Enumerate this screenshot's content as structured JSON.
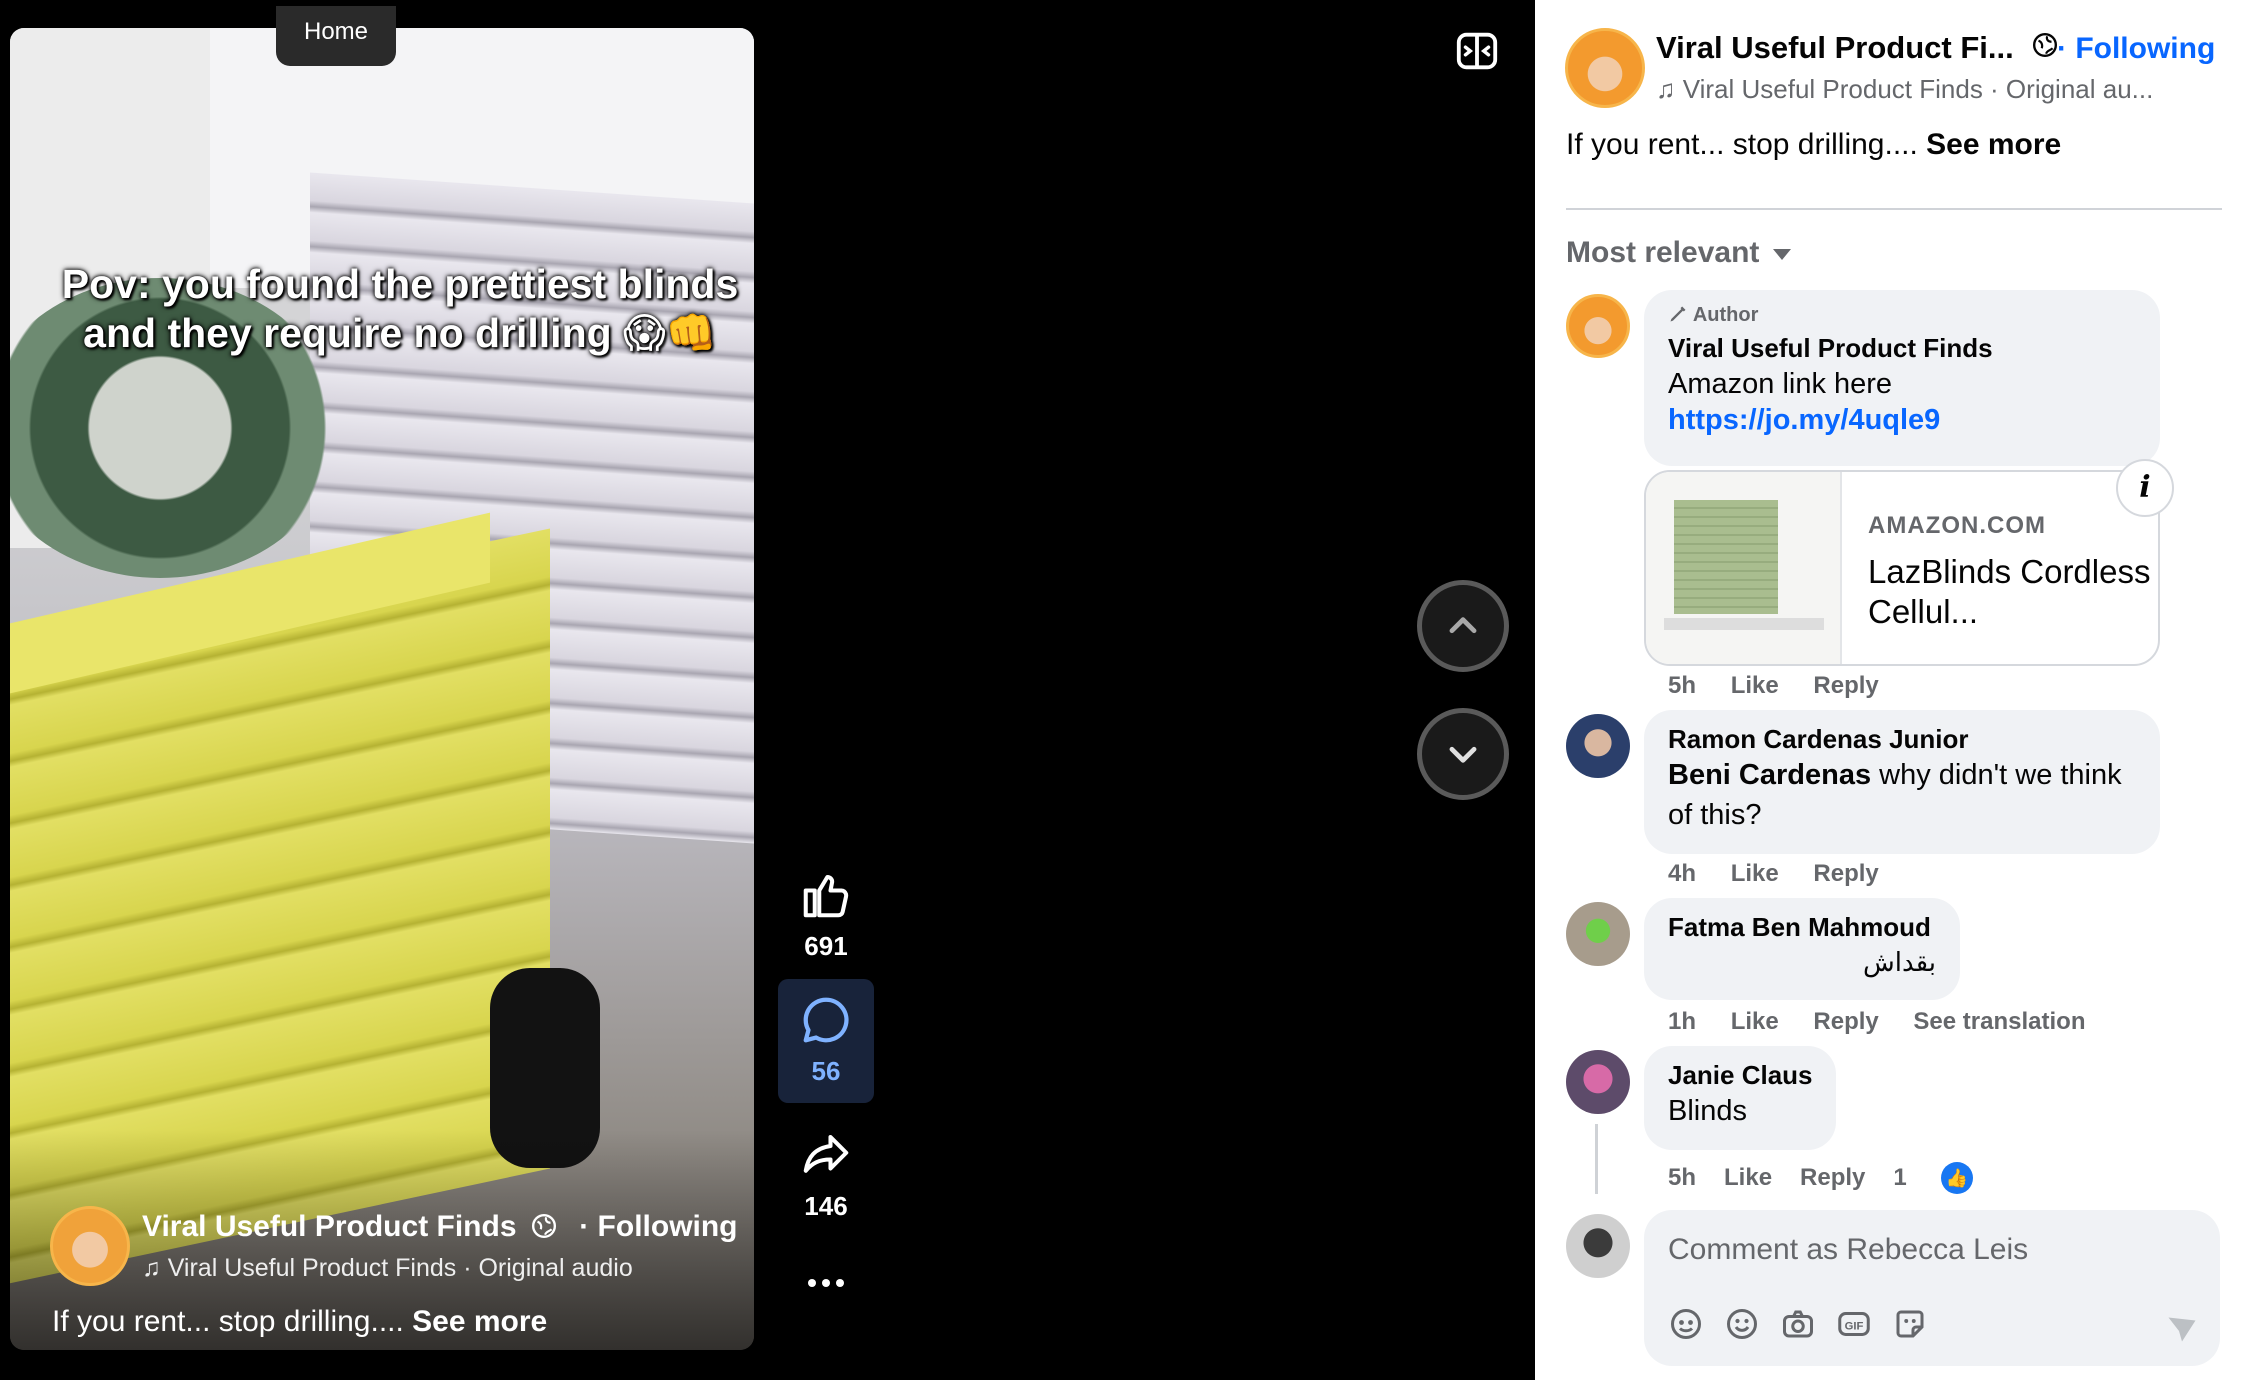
{
  "video": {
    "home_label": "Home",
    "caption": "Pov: you found the prettiest blinds and they require no drilling 😱👊",
    "author": "Viral Useful Product Finds",
    "following_label": "· Following",
    "audio": "Viral Useful Product Finds · Original audio",
    "description": "If you rent... stop drilling....",
    "see_more": "See more"
  },
  "actions": {
    "likes": "691",
    "comments": "56",
    "shares": "146"
  },
  "panel": {
    "header": {
      "name": "Viral Useful Product Fi...",
      "following": "· Following",
      "audio": "Viral Useful Product Finds · Original au...",
      "description": "If you rent... stop drilling....",
      "see_more": "See more"
    },
    "sort_label": "Most relevant",
    "comments": [
      {
        "badge": "Author",
        "name": "Viral Useful Product Finds",
        "text": "Amazon link here",
        "link": "https://jo.my/4uqle9",
        "card": {
          "site": "AMAZON.COM",
          "title": "LazBlinds Cordless Cellul..."
        },
        "time": "5h",
        "like": "Like",
        "reply": "Reply"
      },
      {
        "name": "Ramon Cardenas Junior",
        "mention": "Beni Cardenas",
        "text": "why didn't we think of this?",
        "time": "4h",
        "like": "Like",
        "reply": "Reply"
      },
      {
        "name": "Fatma Ben Mahmoud",
        "text": "بقداش",
        "time": "1h",
        "like": "Like",
        "reply": "Reply",
        "translate": "See translation"
      },
      {
        "name": "Janie Claus",
        "text": "Blinds",
        "time": "5h",
        "like": "Like",
        "reply": "Reply",
        "reactions": "1"
      }
    ],
    "composer": {
      "placeholder": "Comment as Rebecca Leis"
    }
  },
  "colors": {
    "accent": "#0866ff",
    "muted": "#65676b",
    "bubble": "#f0f2f5"
  },
  "icons": [
    "like-icon",
    "comment-icon",
    "share-icon",
    "more-icon",
    "chevron-up-icon",
    "chevron-down-icon",
    "panel-toggle-icon",
    "globe-icon",
    "music-icon",
    "pencil-icon",
    "info-icon",
    "avatar-icon",
    "emoji-icon",
    "camera-icon",
    "gif-icon",
    "sticker-icon",
    "send-icon"
  ]
}
